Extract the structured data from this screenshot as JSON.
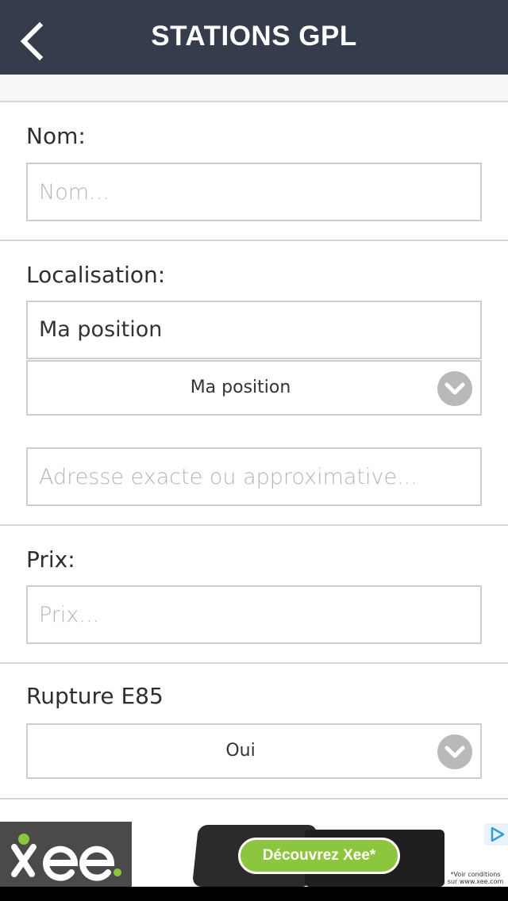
{
  "header": {
    "title": "STATIONS GPL",
    "back_icon": "chevron-left-icon"
  },
  "form": {
    "name": {
      "label": "Nom:",
      "placeholder": "Nom..."
    },
    "location": {
      "label": "Localisation:",
      "value": "Ma position",
      "select_value": "Ma position",
      "address_placeholder": "Adresse exacte ou approximative..."
    },
    "price": {
      "label": "Prix:",
      "placeholder": "Prix..."
    },
    "rupture": {
      "label": "Rupture E85",
      "select_value": "Oui"
    }
  },
  "ad": {
    "brand": "Xee",
    "cta": "Découvrez Xee*",
    "fine_print": "*Voir conditions sur www.xee.com"
  },
  "colors": {
    "header_bg": "#353c4b",
    "ad_cta": "#8cc63f"
  }
}
